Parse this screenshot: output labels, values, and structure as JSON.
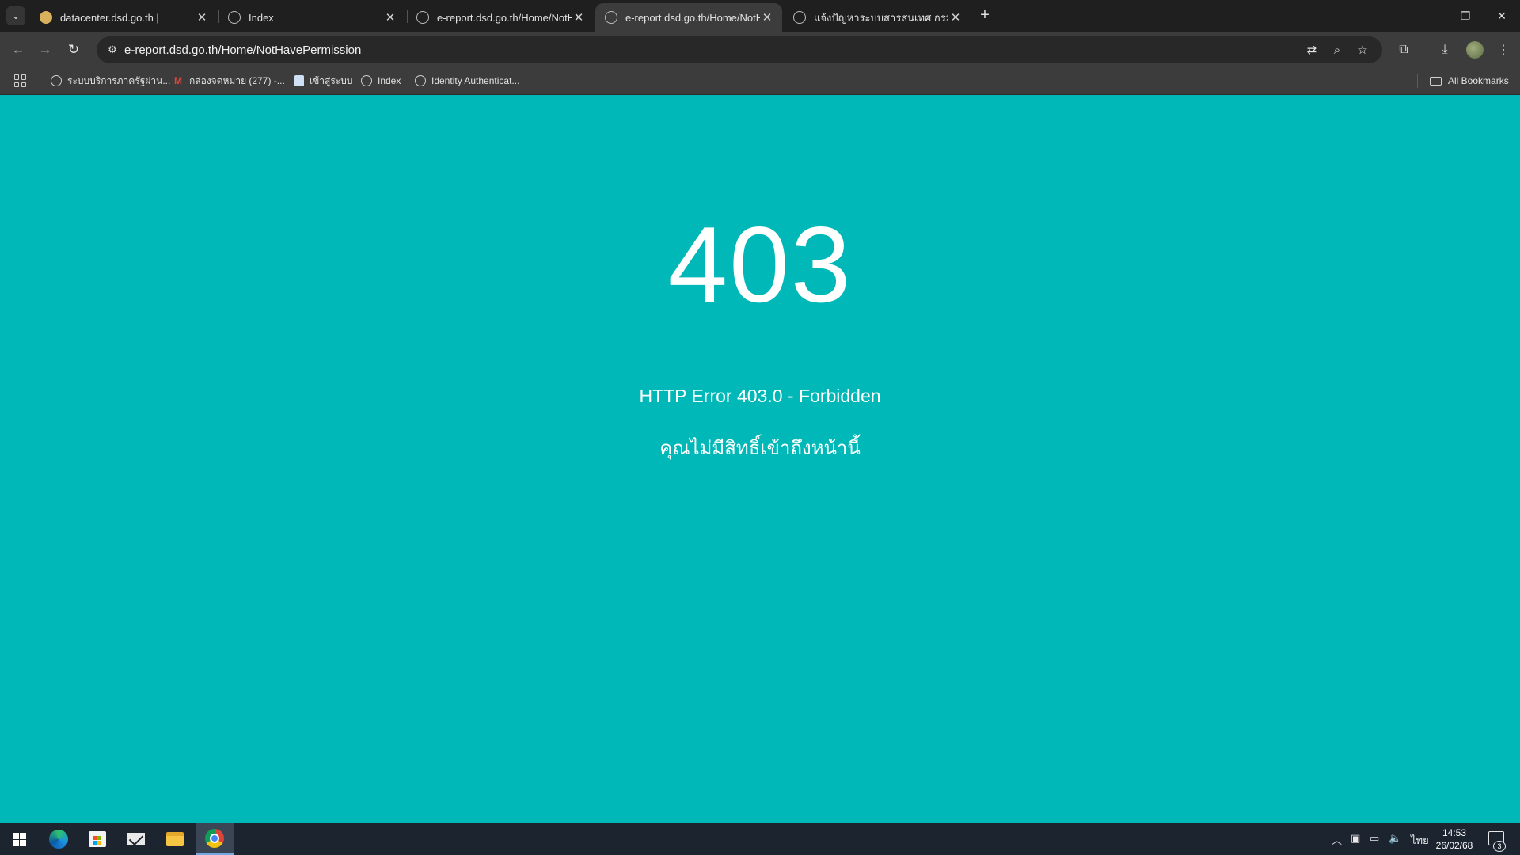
{
  "browser": {
    "tabs": [
      {
        "title": "datacenter.dsd.go.th |",
        "icon": "site-favicon",
        "active": false
      },
      {
        "title": "Index",
        "icon": "globe-icon",
        "active": false
      },
      {
        "title": "e-report.dsd.go.th/Home/NotH",
        "icon": "globe-icon",
        "active": false
      },
      {
        "title": "e-report.dsd.go.th/Home/NotH",
        "icon": "globe-icon",
        "active": true
      },
      {
        "title": "แจ้งปัญหาระบบสารสนเทศ กรมพัฒน",
        "icon": "globe-icon",
        "active": false
      }
    ],
    "tab_close_symbol": "✕",
    "new_tab_symbol": "+",
    "url": "e-report.dsd.go.th/Home/NotHavePermission",
    "bookmarks": [
      {
        "label": "ระบบบริการภาครัฐผ่าน...",
        "icon": "globe-icon"
      },
      {
        "label": "กล่องจดหมาย (277) -...",
        "icon": "gmail-icon"
      },
      {
        "label": "เข้าสู่ระบบ",
        "icon": "document-icon"
      },
      {
        "label": "Index",
        "icon": "globe-icon"
      },
      {
        "label": "Identity Authenticat...",
        "icon": "globe-icon"
      }
    ],
    "all_bookmarks_label": "All Bookmarks"
  },
  "page": {
    "status_code": "403",
    "error_title": "HTTP Error 403.0 - Forbidden",
    "error_message": "คุณไม่มีสิทธิ์เข้าถึงหน้านี้",
    "background_color": "#00b8b8"
  },
  "taskbar": {
    "language": "ไทย",
    "time": "14:53",
    "date": "26/02/68",
    "notification_count": "3"
  }
}
